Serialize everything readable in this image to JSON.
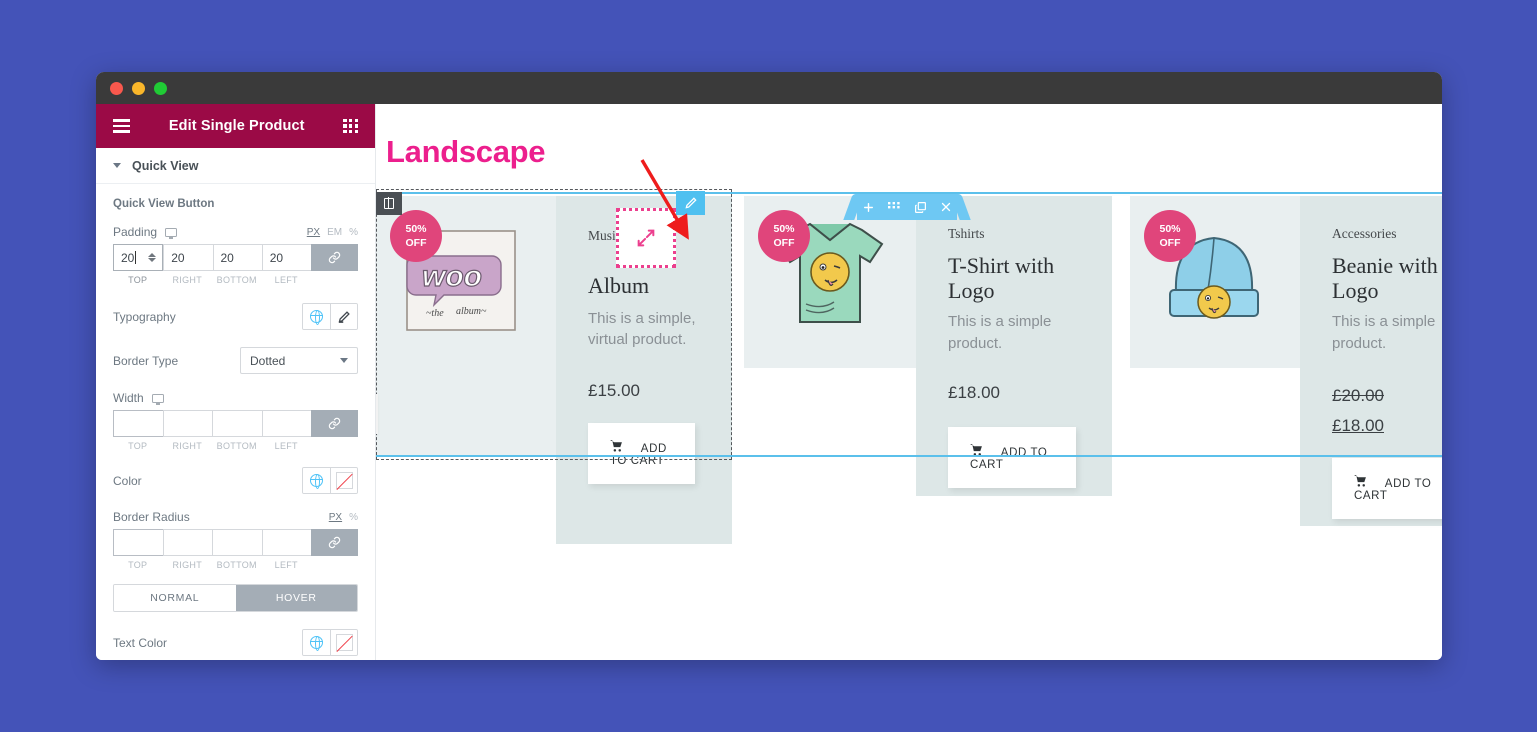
{
  "window": {
    "traffic_lights": [
      "close",
      "minimize",
      "maximize"
    ]
  },
  "sidebar": {
    "header": {
      "title": "Edit Single Product",
      "menu_icon": "hamburger-icon",
      "apps_icon": "grid-apps-icon",
      "background": "#9b0a46"
    },
    "section": {
      "label": "Quick View",
      "caret": "chevron-down-icon",
      "expanded": true
    },
    "subtitle": "Quick View Button",
    "padding": {
      "label": "Padding",
      "device_icon": "desktop-icon",
      "units": [
        "PX",
        "EM",
        "%"
      ],
      "active_unit": "PX",
      "values": {
        "top": "20",
        "right": "20",
        "bottom": "20",
        "left": "20"
      },
      "value_labels": [
        "TOP",
        "RIGHT",
        "BOTTOM",
        "LEFT"
      ],
      "link_icon": "link-icon",
      "linked": true,
      "focused_field": "top"
    },
    "typography": {
      "label": "Typography",
      "globe_icon": "globe-icon",
      "edit_icon": "pencil-icon"
    },
    "border_type": {
      "label": "Border Type",
      "value": "Dotted",
      "caret": "chevron-down-icon"
    },
    "width": {
      "label": "Width",
      "device_icon": "desktop-icon",
      "values": {
        "top": "",
        "right": "",
        "bottom": "",
        "left": ""
      },
      "value_labels": [
        "TOP",
        "RIGHT",
        "BOTTOM",
        "LEFT"
      ],
      "link_icon": "link-icon"
    },
    "color": {
      "label": "Color",
      "globe_icon": "globe-icon",
      "swatch": "no-color-swatch"
    },
    "border_radius": {
      "label": "Border Radius",
      "units": [
        "PX",
        "%"
      ],
      "active_unit": "PX",
      "values": {
        "top": "",
        "right": "",
        "bottom": "",
        "left": ""
      },
      "value_labels": [
        "TOP",
        "RIGHT",
        "BOTTOM",
        "LEFT"
      ],
      "link_icon": "link-icon"
    },
    "state_tabs": {
      "normal": "NORMAL",
      "hover": "HOVER",
      "active": "HOVER"
    },
    "text_color": {
      "label": "Text Color",
      "globe_icon": "globe-icon",
      "swatch": "no-color-swatch"
    }
  },
  "canvas": {
    "page_title": "Landscape",
    "page_title_color": "#ec1f8d",
    "section_toolbar": {
      "add_icon": "plus-icon",
      "grid_icon": "grid-dots-icon",
      "duplicate_icon": "copy-icon",
      "close_icon": "close-icon",
      "color": "#6ec8f3"
    },
    "column_handle_icon": "column-handle-icon",
    "panel_collapse_icon": "chevron-left-icon",
    "quick_view": {
      "icon": "expand-arrows-icon",
      "selected": true,
      "border_color": "#ec3f8e",
      "edit_icon": "pencil-icon",
      "edit_bg": "#4ec0f0"
    },
    "annotation_arrow": {
      "color": "#ee1c1c"
    },
    "products": [
      {
        "category": "Music",
        "name": "Album",
        "description": "This is a simple, virtual product.",
        "price": "£15.00",
        "old_price": "",
        "on_sale_badge": {
          "line1": "50%",
          "line2": "OFF"
        },
        "add_to_cart": "ADD TO CART",
        "cart_icon": "cart-icon",
        "image": "woo-album-cover"
      },
      {
        "category": "Tshirts",
        "name": "T-Shirt with Logo",
        "description": "This is a simple product.",
        "price": "£18.00",
        "old_price": "",
        "on_sale_badge": {
          "line1": "50%",
          "line2": "OFF"
        },
        "add_to_cart": "ADD TO CART",
        "cart_icon": "cart-icon",
        "image": "green-tshirt"
      },
      {
        "category": "Accessories",
        "name": "Beanie with Logo",
        "description": "This is a simple product.",
        "price": "£18.00",
        "old_price": "£20.00",
        "on_sale_badge": {
          "line1": "50%",
          "line2": "OFF"
        },
        "add_to_cart": "ADD TO CART",
        "cart_icon": "cart-icon",
        "image": "blue-beanie"
      }
    ]
  }
}
